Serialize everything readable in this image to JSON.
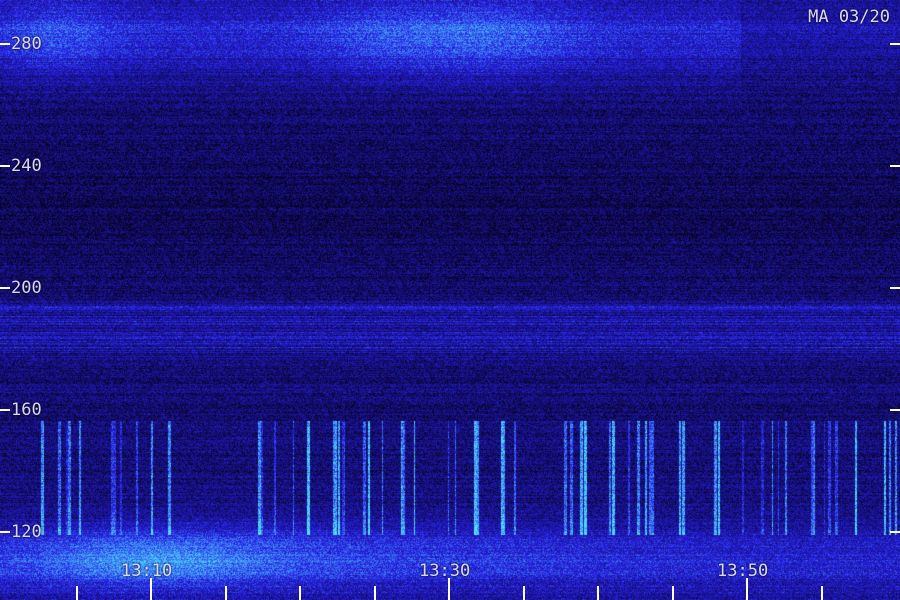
{
  "station_label": "MA 03/20",
  "y_axis": {
    "ticks": [
      280,
      240,
      200,
      160,
      120
    ],
    "range": [
      105,
      290
    ]
  },
  "x_axis": {
    "labels": [
      "13:10",
      "13:30",
      "13:50"
    ],
    "label_minutes": [
      10,
      30,
      50
    ],
    "minor_tick_minutes": 5,
    "range_minutes": [
      0,
      60
    ]
  },
  "colors": {
    "background": "#0a0640",
    "signal_low": "#1a10a0",
    "signal_mid": "#2a3cff",
    "signal_high": "#3fe0ff",
    "text": "#d8d8ff"
  }
}
